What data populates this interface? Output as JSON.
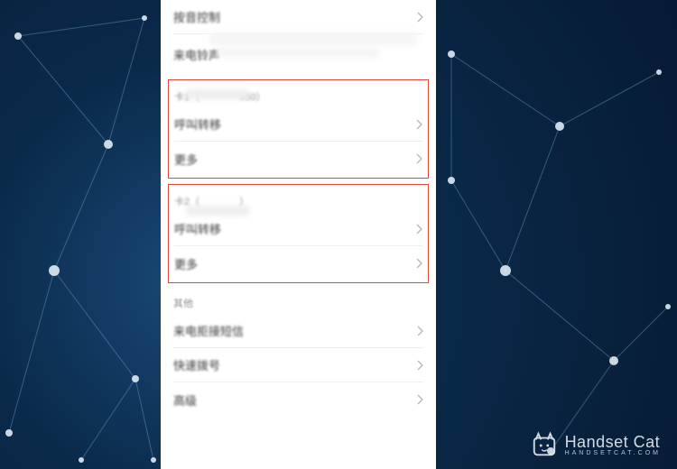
{
  "top": {
    "voice_control": "按音控制",
    "incoming_ringtone": "来电铃声"
  },
  "sim1": {
    "header": "卡1（　　　　950）",
    "call_forward": "呼叫转移",
    "more": "更多"
  },
  "sim2": {
    "header": "卡2（　　　　）",
    "call_forward": "呼叫转移",
    "more": "更多"
  },
  "other": {
    "header": "其他",
    "call_reject_sms": "来电拒接短信",
    "speed_dial": "快速拨号",
    "advanced": "高级"
  },
  "watermark": {
    "line1": "Handset Cat",
    "line2": "HANDSETCAT.COM"
  }
}
